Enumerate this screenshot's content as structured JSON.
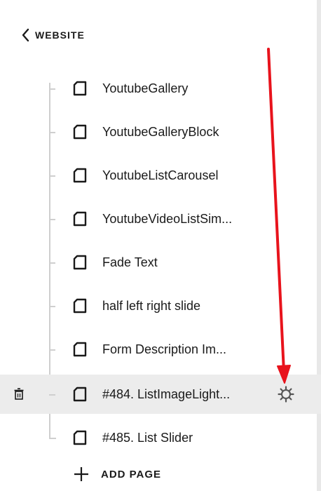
{
  "header": {
    "back_label": "WEBSITE"
  },
  "pages": [
    {
      "label": "YoutubeGallery"
    },
    {
      "label": "YoutubeGalleryBlock"
    },
    {
      "label": "YoutubeListCarousel"
    },
    {
      "label": "YoutubeVideoListSim..."
    },
    {
      "label": "Fade Text"
    },
    {
      "label": "half left right slide"
    },
    {
      "label": "Form Description Im..."
    },
    {
      "label": "#484. ListImageLight..."
    },
    {
      "label": "#485. List Slider"
    }
  ],
  "footer": {
    "add_page_label": "ADD PAGE"
  },
  "colors": {
    "annotation_arrow": "#e8131c",
    "active_row": "#ececec"
  },
  "icons": {
    "back": "chevron-left-icon",
    "page": "page-icon",
    "delete": "trash-icon",
    "settings": "gear-icon",
    "add": "plus-icon"
  }
}
